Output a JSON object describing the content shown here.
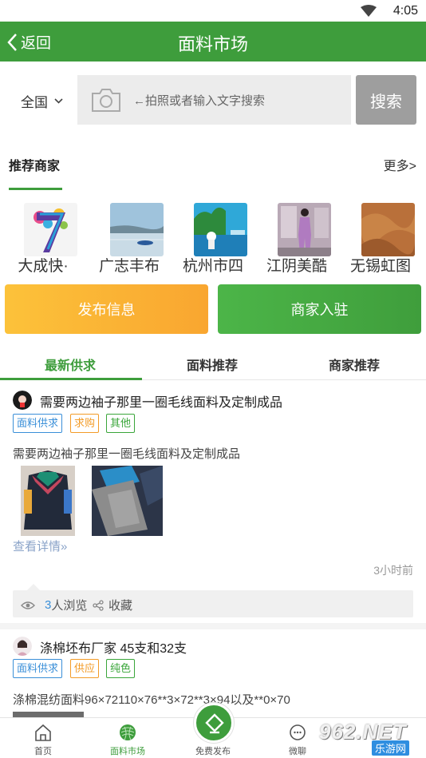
{
  "status_bar": {
    "time": "4:05"
  },
  "header": {
    "back_label": "返回",
    "title": "面料市场"
  },
  "search": {
    "region": "全国",
    "placeholder": "←拍照或者输入文字搜索",
    "button": "搜索"
  },
  "recommended": {
    "title": "推荐商家",
    "more": "更多>",
    "merchants": [
      {
        "name": "大成快·"
      },
      {
        "name": "广志丰布"
      },
      {
        "name": "杭州市四"
      },
      {
        "name": "江阴美酷"
      },
      {
        "name": "无锡虹图"
      }
    ]
  },
  "actions": {
    "publish": "发布信息",
    "join": "商家入驻"
  },
  "tabs": [
    {
      "label": "最新供求"
    },
    {
      "label": "面料推荐"
    },
    {
      "label": "商家推荐"
    }
  ],
  "posts": [
    {
      "title": "需要两边袖子那里一圈毛线面料及定制成品",
      "tags": [
        "面料供求",
        "求购",
        "其他"
      ],
      "desc": "需要两边袖子那里一圈毛线面料及定制成品",
      "detail_link": "查看详情»",
      "time_ago": "3小时前",
      "views": "3",
      "views_label": "人浏览",
      "fav_label": "收藏"
    },
    {
      "title": "涤棉坯布厂家 45支和32支",
      "tags": [
        "面料供求",
        "供应",
        "纯色"
      ],
      "desc": "涤棉混纺面料96×72110×76**3×72**3×94以及**0×70"
    }
  ],
  "bottom_nav": [
    {
      "label": "首页",
      "icon": "home-icon"
    },
    {
      "label": "面料市场",
      "icon": "fabric-icon"
    },
    {
      "label": "免费发布",
      "icon": "edit-icon"
    },
    {
      "label": "微聊",
      "icon": "chat-icon"
    }
  ],
  "watermark": {
    "text": "962.NET",
    "sub": "乐游网"
  },
  "colors": {
    "primary_green": "#3e9d3c",
    "orange": "#f9a630",
    "tag_blue": "#3a8fd8",
    "tag_orange": "#f39c28",
    "tag_green": "#3aa63a"
  }
}
